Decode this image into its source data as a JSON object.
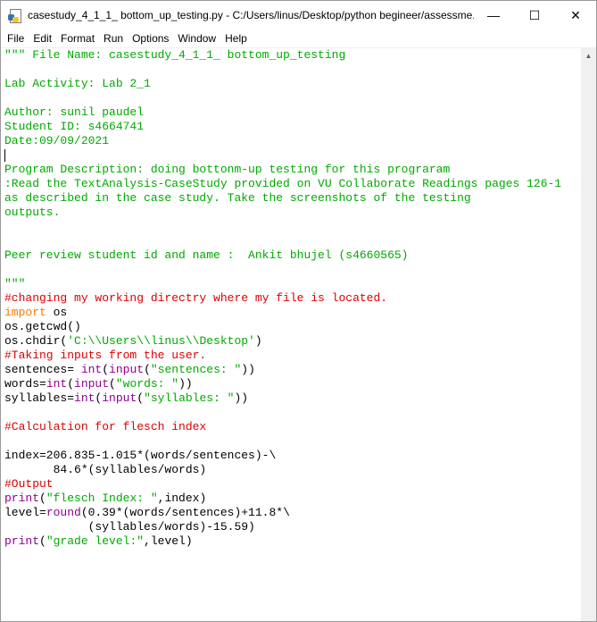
{
  "window": {
    "title": "casestudy_4_1_1_ bottom_up_testing.py - C:/Users/linus/Desktop/python begineer/assessme...",
    "controls": {
      "minimize": "—",
      "maximize": "☐",
      "close": "✕"
    }
  },
  "menu": [
    "File",
    "Edit",
    "Format",
    "Run",
    "Options",
    "Window",
    "Help"
  ],
  "editor": {
    "lines": [
      [
        {
          "t": "\"\"\" File Name: casestudy_4_1_1_ bottom_up_testing",
          "c": "str"
        }
      ],
      [],
      [
        {
          "t": "Lab Activity: Lab 2_1",
          "c": "str"
        }
      ],
      [],
      [
        {
          "t": "Author: sunil paudel",
          "c": "str"
        }
      ],
      [
        {
          "t": "Student ID: s4664741",
          "c": "str"
        }
      ],
      [
        {
          "t": "Date:09/09/2021",
          "c": "str"
        }
      ],
      [
        {
          "t": "",
          "c": "caret"
        }
      ],
      [
        {
          "t": "Program Description: doing bottonm-up testing for this prograram",
          "c": "str"
        }
      ],
      [
        {
          "t": ":Read the TextAnalysis-CaseStudy provided on VU Collaborate Readings pages 126-1",
          "c": "str"
        }
      ],
      [
        {
          "t": "as described in the case study. Take the screenshots of the testing",
          "c": "str"
        }
      ],
      [
        {
          "t": "outputs.",
          "c": "str"
        }
      ],
      [],
      [],
      [
        {
          "t": "Peer review student id and name :  Ankit bhujel (s4660565)",
          "c": "str"
        }
      ],
      [],
      [
        {
          "t": "\"\"\"",
          "c": "str"
        }
      ],
      [
        {
          "t": "#changing my working directry where my file is located.",
          "c": "com"
        }
      ],
      [
        {
          "t": "import",
          "c": "kw"
        },
        {
          "t": " os",
          "c": ""
        }
      ],
      [
        {
          "t": "os.getcwd()",
          "c": ""
        }
      ],
      [
        {
          "t": "os.chdir(",
          "c": ""
        },
        {
          "t": "'C:\\\\Users\\\\linus\\\\Desktop'",
          "c": "str"
        },
        {
          "t": ")",
          "c": ""
        }
      ],
      [
        {
          "t": "#Taking inputs from the user.",
          "c": "com"
        }
      ],
      [
        {
          "t": "sentences= ",
          "c": ""
        },
        {
          "t": "int",
          "c": "bi"
        },
        {
          "t": "(",
          "c": ""
        },
        {
          "t": "input",
          "c": "bi"
        },
        {
          "t": "(",
          "c": ""
        },
        {
          "t": "\"sentences: \"",
          "c": "str"
        },
        {
          "t": "))",
          "c": ""
        }
      ],
      [
        {
          "t": "words=",
          "c": ""
        },
        {
          "t": "int",
          "c": "bi"
        },
        {
          "t": "(",
          "c": ""
        },
        {
          "t": "input",
          "c": "bi"
        },
        {
          "t": "(",
          "c": ""
        },
        {
          "t": "\"words: \"",
          "c": "str"
        },
        {
          "t": "))",
          "c": ""
        }
      ],
      [
        {
          "t": "syllables=",
          "c": ""
        },
        {
          "t": "int",
          "c": "bi"
        },
        {
          "t": "(",
          "c": ""
        },
        {
          "t": "input",
          "c": "bi"
        },
        {
          "t": "(",
          "c": ""
        },
        {
          "t": "\"syllables: \"",
          "c": "str"
        },
        {
          "t": "))",
          "c": ""
        }
      ],
      [],
      [
        {
          "t": "#Calculation for flesch index",
          "c": "com"
        }
      ],
      [],
      [
        {
          "t": "index=206.835-1.015*(words/sentences)-\\",
          "c": ""
        }
      ],
      [
        {
          "t": "       84.6*(syllables/words)",
          "c": ""
        }
      ],
      [
        {
          "t": "#Output",
          "c": "com"
        }
      ],
      [
        {
          "t": "print",
          "c": "bi"
        },
        {
          "t": "(",
          "c": ""
        },
        {
          "t": "\"flesch Index: \"",
          "c": "str"
        },
        {
          "t": ",index)",
          "c": ""
        }
      ],
      [
        {
          "t": "level=",
          "c": ""
        },
        {
          "t": "round",
          "c": "bi"
        },
        {
          "t": "(0.39*(words/sentences)+11.8*\\",
          "c": ""
        }
      ],
      [
        {
          "t": "            (syllables/words)-15.59)",
          "c": ""
        }
      ],
      [
        {
          "t": "print",
          "c": "bi"
        },
        {
          "t": "(",
          "c": ""
        },
        {
          "t": "\"grade level:\"",
          "c": "str"
        },
        {
          "t": ",level)",
          "c": ""
        }
      ]
    ]
  },
  "colors": {
    "string": "#00aa00",
    "comment": "#dd0000",
    "keyword": "#ff7700",
    "builtin": "#900090"
  },
  "icons": {
    "app": "python-file-icon",
    "scroll_up": "scroll-up-arrow-icon",
    "scroll_down": "scroll-down-arrow-icon"
  }
}
